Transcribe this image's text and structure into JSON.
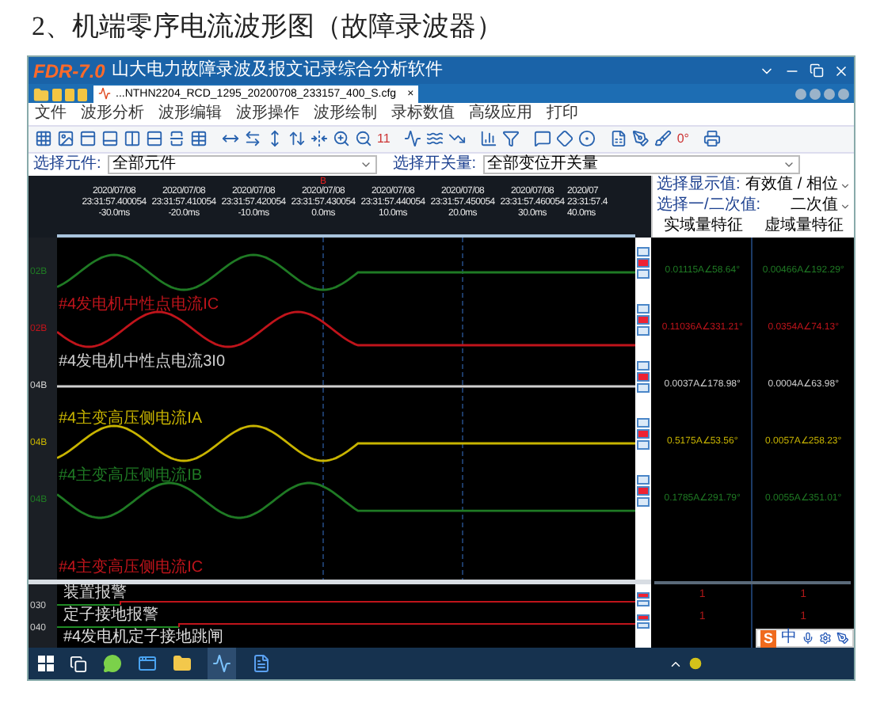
{
  "heading": "2、机端零序电流波形图（故障录波器）",
  "window": {
    "logo": "FDR-7.0",
    "title": "山大电力故障录波及报文记录综合分析软件"
  },
  "tab": {
    "label": "...NTHN2204_RCD_1295_20200708_233157_400_S.cfg",
    "close": "×"
  },
  "menu": [
    "文件",
    "波形分析",
    "波形编辑",
    "波形操作",
    "波形绘制",
    "录标数值",
    "高级应用",
    "打印"
  ],
  "toolbar": {
    "labels": [
      "11",
      "0°"
    ]
  },
  "filters": [
    {
      "label": "选择元件:",
      "value": "全部元件"
    },
    {
      "label": "选择开关量:",
      "value": "全部变位开关量"
    }
  ],
  "cursor": {
    "label": "B"
  },
  "time_axis": [
    {
      "date": "2020/07/08",
      "time": "23:31:57.400054",
      "offset": "-30.0ms"
    },
    {
      "date": "2020/07/08",
      "time": "23:31:57.410054",
      "offset": "-20.0ms"
    },
    {
      "date": "2020/07/08",
      "time": "23:31:57.420054",
      "offset": "-10.0ms"
    },
    {
      "date": "2020/07/08",
      "time": "23:31:57.430054",
      "offset": "0.0ms"
    },
    {
      "date": "2020/07/08",
      "time": "23:31:57.440054",
      "offset": "10.0ms"
    },
    {
      "date": "2020/07/08",
      "time": "23:31:57.450054",
      "offset": "20.0ms"
    },
    {
      "date": "2020/07/08",
      "time": "23:31:57.460054",
      "offset": "30.0ms"
    },
    {
      "date": "2020/07",
      "time": "23:31:57.4",
      "offset": "40.0ms"
    }
  ],
  "display": [
    {
      "label": "选择显示值:",
      "value": "有效值 / 相位"
    },
    {
      "label": "选择一/二次值:",
      "value": "二次值"
    }
  ],
  "columns": [
    "实域量特征",
    "虚域量特征"
  ],
  "channels": [
    {
      "ylabel": "02B",
      "color": "#1f7a24",
      "kind": "wave",
      "real": "0.01115A∠58.64°",
      "imag": "0.00466A∠192.29°"
    },
    {
      "name": "#4发电机中性点电流IC",
      "ylabel": "02B",
      "color": "#c0141b",
      "kind": "wave",
      "real": "0.11036A∠331.21°",
      "imag": "0.0354A∠74.13°"
    },
    {
      "name": "#4发电机中性点电流3I0",
      "ylabel": "04B",
      "color": "#d0d0d0",
      "kind": "flat",
      "real": "0.0037A∠178.98°",
      "imag": "0.0004A∠63.98°"
    },
    {
      "name": "#4主变高压侧电流IA",
      "ylabel": "04B",
      "color": "#c8b400",
      "kind": "wave",
      "real": "0.5175A∠53.56°",
      "imag": "0.0057A∠258.23°"
    },
    {
      "name": "#4主变高压侧电流IB",
      "ylabel": "04B",
      "color": "#1f7a24",
      "kind": "wave",
      "real": "0.1785A∠291.79°",
      "imag": "0.0055A∠351.01°"
    },
    {
      "name": "#4主变高压侧电流IC",
      "color": "#c0141b",
      "kind": "hidden"
    }
  ],
  "digital": [
    {
      "name": "装置报警",
      "ylabel": "030",
      "values": [
        "1",
        "1"
      ]
    },
    {
      "name": "定子接地报警",
      "ylabel": "040",
      "values": [
        "1",
        "1"
      ]
    },
    {
      "name": "#4发电机定子接地跳闸"
    }
  ],
  "ime": {
    "logo": "S",
    "mode": "中"
  }
}
